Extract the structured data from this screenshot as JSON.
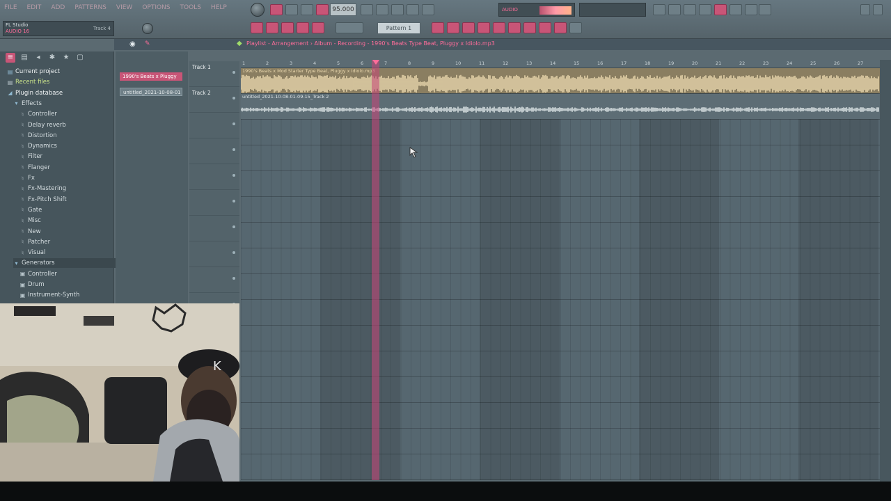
{
  "app": {
    "title_line1": "FL Studio",
    "title_line2": "AUDIO 16",
    "title_line3": "Track 4",
    "tempo": "95.000",
    "pattern": "Pattern 1",
    "monitor_label": "AUDIO",
    "menu": [
      "FILE",
      "EDIT",
      "ADD",
      "PATTERNS",
      "VIEW",
      "OPTIONS",
      "TOOLS",
      "HELP"
    ]
  },
  "playlist": {
    "title": "Playlist - Arrangement › Album - Recording - 1990's Beats Type Beat, Pluggy x Idiolo.mp3",
    "clip_buttons": [
      "1990's Beats x Pluggy",
      "untitled_2021-10-08-01"
    ],
    "tracks": [
      {
        "name": "Track 1"
      },
      {
        "name": "Track 2"
      },
      {
        "name": ""
      },
      {
        "name": ""
      },
      {
        "name": ""
      },
      {
        "name": ""
      },
      {
        "name": ""
      },
      {
        "name": ""
      },
      {
        "name": ""
      },
      {
        "name": ""
      },
      {
        "name": ""
      },
      {
        "name": ""
      },
      {
        "name": ""
      },
      {
        "name": ""
      },
      {
        "name": ""
      },
      {
        "name": ""
      }
    ],
    "clips": [
      {
        "track": 0,
        "label": "1990's Beats x Mod Starter Type Beat, Pluggy x Idiolo.mp3",
        "color": "#e9d7ad",
        "bg": "#8a7e61"
      },
      {
        "track": 1,
        "label": "untitled_2021-10-08-01-09-15_Track 2",
        "color": "#dfe6e8",
        "bg": "#5d6d75"
      }
    ],
    "playhead_bar": 5,
    "ruler_bars": [
      "1",
      "2",
      "3",
      "4",
      "5",
      "6",
      "7",
      "8",
      "9",
      "10",
      "11",
      "12",
      "13",
      "14",
      "15",
      "16",
      "17",
      "18",
      "19",
      "20",
      "21",
      "22",
      "23",
      "24",
      "25",
      "26",
      "27"
    ]
  },
  "browser": {
    "tree": [
      {
        "label": "Current project",
        "type": "root",
        "glyph": "▤",
        "level": 0
      },
      {
        "label": "Recent files",
        "type": "recent",
        "glyph": "▤",
        "level": 0
      },
      {
        "label": "Plugin database",
        "type": "root",
        "glyph": "◢",
        "level": 0
      },
      {
        "label": "Effects",
        "type": "folder",
        "glyph": "▾",
        "level": 1
      },
      {
        "label": "Controller",
        "type": "item",
        "glyph": "♮",
        "level": 2
      },
      {
        "label": "Delay reverb",
        "type": "item",
        "glyph": "♮",
        "level": 2
      },
      {
        "label": "Distortion",
        "type": "item",
        "glyph": "♮",
        "level": 2
      },
      {
        "label": "Dynamics",
        "type": "item",
        "glyph": "♮",
        "level": 2
      },
      {
        "label": "Filter",
        "type": "item",
        "glyph": "♮",
        "level": 2
      },
      {
        "label": "Flanger",
        "type": "item",
        "glyph": "♮",
        "level": 2
      },
      {
        "label": "Fx",
        "type": "item",
        "glyph": "♮",
        "level": 2
      },
      {
        "label": "Fx-Mastering",
        "type": "item",
        "glyph": "♮",
        "level": 2
      },
      {
        "label": "Fx-Pitch Shift",
        "type": "item",
        "glyph": "♮",
        "level": 2
      },
      {
        "label": "Gate",
        "type": "item",
        "glyph": "♮",
        "level": 2
      },
      {
        "label": "Misc",
        "type": "item",
        "glyph": "♮",
        "level": 2
      },
      {
        "label": "New",
        "type": "item",
        "glyph": "♮",
        "level": 2
      },
      {
        "label": "Patcher",
        "type": "item",
        "glyph": "♮",
        "level": 2
      },
      {
        "label": "Visual",
        "type": "item",
        "glyph": "♮",
        "level": 2
      },
      {
        "label": "Generators",
        "type": "folder-hl",
        "glyph": "▾",
        "level": 1
      },
      {
        "label": "Controller",
        "type": "item",
        "glyph": "▣",
        "level": 2
      },
      {
        "label": "Drum",
        "type": "item",
        "glyph": "▣",
        "level": 2
      },
      {
        "label": "Instrument-Synth",
        "type": "item",
        "glyph": "▣",
        "level": 2
      }
    ]
  },
  "colors": {
    "accent": "#ff6d9a",
    "clip_audio": "#e9d7ad",
    "playhead": "#c84678"
  }
}
